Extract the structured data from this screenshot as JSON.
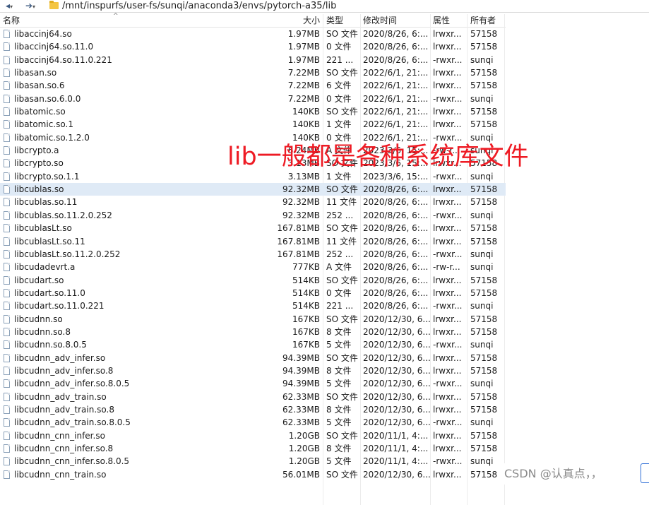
{
  "toolbar": {
    "back_glyph": "◂",
    "forward_glyph": "➔",
    "path": "/mnt/inspurfs/user-fs/sunqi/anaconda3/envs/pytorch-a35/lib"
  },
  "columns": {
    "name": "名称",
    "size": "大小",
    "type": "类型",
    "modified": "修改时间",
    "attributes": "属性",
    "owner": "所有者"
  },
  "files": [
    {
      "name": "libaccinj64.so",
      "size": "1.97MB",
      "type": "SO 文件",
      "modified": "2020/8/26, 6:...",
      "attr": "lrwxr...",
      "owner": "57158"
    },
    {
      "name": "libaccinj64.so.11.0",
      "size": "1.97MB",
      "type": "0 文件",
      "modified": "2020/8/26, 6:...",
      "attr": "lrwxr...",
      "owner": "57158"
    },
    {
      "name": "libaccinj64.so.11.0.221",
      "size": "1.97MB",
      "type": "221 ...",
      "modified": "2020/8/26, 6:...",
      "attr": "-rwxr...",
      "owner": "sunqi"
    },
    {
      "name": "libasan.so",
      "size": "7.22MB",
      "type": "SO 文件",
      "modified": "2022/6/1, 21:...",
      "attr": "lrwxr...",
      "owner": "57158"
    },
    {
      "name": "libasan.so.6",
      "size": "7.22MB",
      "type": "6 文件",
      "modified": "2022/6/1, 21:...",
      "attr": "lrwxr...",
      "owner": "57158"
    },
    {
      "name": "libasan.so.6.0.0",
      "size": "7.22MB",
      "type": "0 文件",
      "modified": "2022/6/1, 21:...",
      "attr": "-rwxr...",
      "owner": "sunqi"
    },
    {
      "name": "libatomic.so",
      "size": "140KB",
      "type": "SO 文件",
      "modified": "2022/6/1, 21:...",
      "attr": "lrwxr...",
      "owner": "57158"
    },
    {
      "name": "libatomic.so.1",
      "size": "140KB",
      "type": "1 文件",
      "modified": "2022/6/1, 21:...",
      "attr": "lrwxr...",
      "owner": "57158"
    },
    {
      "name": "libatomic.so.1.2.0",
      "size": "140KB",
      "type": "0 文件",
      "modified": "2022/6/1, 21:...",
      "attr": "-rwxr...",
      "owner": "sunqi"
    },
    {
      "name": "libcrypto.a",
      "size": "6.24MB",
      "type": "A 文件",
      "modified": "2023/3/6, 15:...",
      "attr": "-rw-r...",
      "owner": "sunqi"
    },
    {
      "name": "libcrypto.so",
      "size": "3.13MB",
      "type": "SO 文件",
      "modified": "2023/3/6, 15:...",
      "attr": "lrwxr...",
      "owner": "57158"
    },
    {
      "name": "libcrypto.so.1.1",
      "size": "3.13MB",
      "type": "1 文件",
      "modified": "2023/3/6, 15:...",
      "attr": "-rwxr...",
      "owner": "sunqi"
    },
    {
      "name": "libcublas.so",
      "size": "92.32MB",
      "type": "SO 文件",
      "modified": "2020/8/26, 6:...",
      "attr": "lrwxr...",
      "owner": "57158",
      "selected": true
    },
    {
      "name": "libcublas.so.11",
      "size": "92.32MB",
      "type": "11 文件",
      "modified": "2020/8/26, 6:...",
      "attr": "lrwxr...",
      "owner": "57158"
    },
    {
      "name": "libcublas.so.11.2.0.252",
      "size": "92.32MB",
      "type": "252 ...",
      "modified": "2020/8/26, 6:...",
      "attr": "-rwxr...",
      "owner": "sunqi"
    },
    {
      "name": "libcublasLt.so",
      "size": "167.81MB",
      "type": "SO 文件",
      "modified": "2020/8/26, 6:...",
      "attr": "lrwxr...",
      "owner": "57158"
    },
    {
      "name": "libcublasLt.so.11",
      "size": "167.81MB",
      "type": "11 文件",
      "modified": "2020/8/26, 6:...",
      "attr": "lrwxr...",
      "owner": "57158"
    },
    {
      "name": "libcublasLt.so.11.2.0.252",
      "size": "167.81MB",
      "type": "252 ...",
      "modified": "2020/8/26, 6:...",
      "attr": "-rwxr...",
      "owner": "sunqi"
    },
    {
      "name": "libcudadevrt.a",
      "size": "777KB",
      "type": "A 文件",
      "modified": "2020/8/26, 6:...",
      "attr": "-rw-r...",
      "owner": "sunqi"
    },
    {
      "name": "libcudart.so",
      "size": "514KB",
      "type": "SO 文件",
      "modified": "2020/8/26, 6:...",
      "attr": "lrwxr...",
      "owner": "57158"
    },
    {
      "name": "libcudart.so.11.0",
      "size": "514KB",
      "type": "0 文件",
      "modified": "2020/8/26, 6:...",
      "attr": "lrwxr...",
      "owner": "57158"
    },
    {
      "name": "libcudart.so.11.0.221",
      "size": "514KB",
      "type": "221 ...",
      "modified": "2020/8/26, 6:...",
      "attr": "-rwxr...",
      "owner": "sunqi"
    },
    {
      "name": "libcudnn.so",
      "size": "167KB",
      "type": "SO 文件",
      "modified": "2020/12/30, 6...",
      "attr": "lrwxr...",
      "owner": "57158"
    },
    {
      "name": "libcudnn.so.8",
      "size": "167KB",
      "type": "8 文件",
      "modified": "2020/12/30, 6...",
      "attr": "lrwxr...",
      "owner": "57158"
    },
    {
      "name": "libcudnn.so.8.0.5",
      "size": "167KB",
      "type": "5 文件",
      "modified": "2020/12/30, 6...",
      "attr": "-rwxr...",
      "owner": "sunqi"
    },
    {
      "name": "libcudnn_adv_infer.so",
      "size": "94.39MB",
      "type": "SO 文件",
      "modified": "2020/12/30, 6...",
      "attr": "lrwxr...",
      "owner": "57158"
    },
    {
      "name": "libcudnn_adv_infer.so.8",
      "size": "94.39MB",
      "type": "8 文件",
      "modified": "2020/12/30, 6...",
      "attr": "lrwxr...",
      "owner": "57158"
    },
    {
      "name": "libcudnn_adv_infer.so.8.0.5",
      "size": "94.39MB",
      "type": "5 文件",
      "modified": "2020/12/30, 6...",
      "attr": "-rwxr...",
      "owner": "sunqi"
    },
    {
      "name": "libcudnn_adv_train.so",
      "size": "62.33MB",
      "type": "SO 文件",
      "modified": "2020/12/30, 6...",
      "attr": "lrwxr...",
      "owner": "57158"
    },
    {
      "name": "libcudnn_adv_train.so.8",
      "size": "62.33MB",
      "type": "8 文件",
      "modified": "2020/12/30, 6...",
      "attr": "lrwxr...",
      "owner": "57158"
    },
    {
      "name": "libcudnn_adv_train.so.8.0.5",
      "size": "62.33MB",
      "type": "5 文件",
      "modified": "2020/12/30, 6...",
      "attr": "-rwxr...",
      "owner": "sunqi"
    },
    {
      "name": "libcudnn_cnn_infer.so",
      "size": "1.20GB",
      "type": "SO 文件",
      "modified": "2020/11/1, 4:...",
      "attr": "lrwxr...",
      "owner": "57158"
    },
    {
      "name": "libcudnn_cnn_infer.so.8",
      "size": "1.20GB",
      "type": "8 文件",
      "modified": "2020/11/1, 4:...",
      "attr": "lrwxr...",
      "owner": "57158"
    },
    {
      "name": "libcudnn_cnn_infer.so.8.0.5",
      "size": "1.20GB",
      "type": "5 文件",
      "modified": "2020/11/1, 4:...",
      "attr": "-rwxr...",
      "owner": "sunqi"
    },
    {
      "name": "libcudnn_cnn_train.so",
      "size": "56.01MB",
      "type": "SO 文件",
      "modified": "2020/12/30, 6...",
      "attr": "lrwxr...",
      "owner": "57158"
    }
  ],
  "annotation": {
    "text": "lib一般都是各种系统库文件",
    "color": "#ee1b24"
  },
  "watermark": "CSDN @认真点，，"
}
